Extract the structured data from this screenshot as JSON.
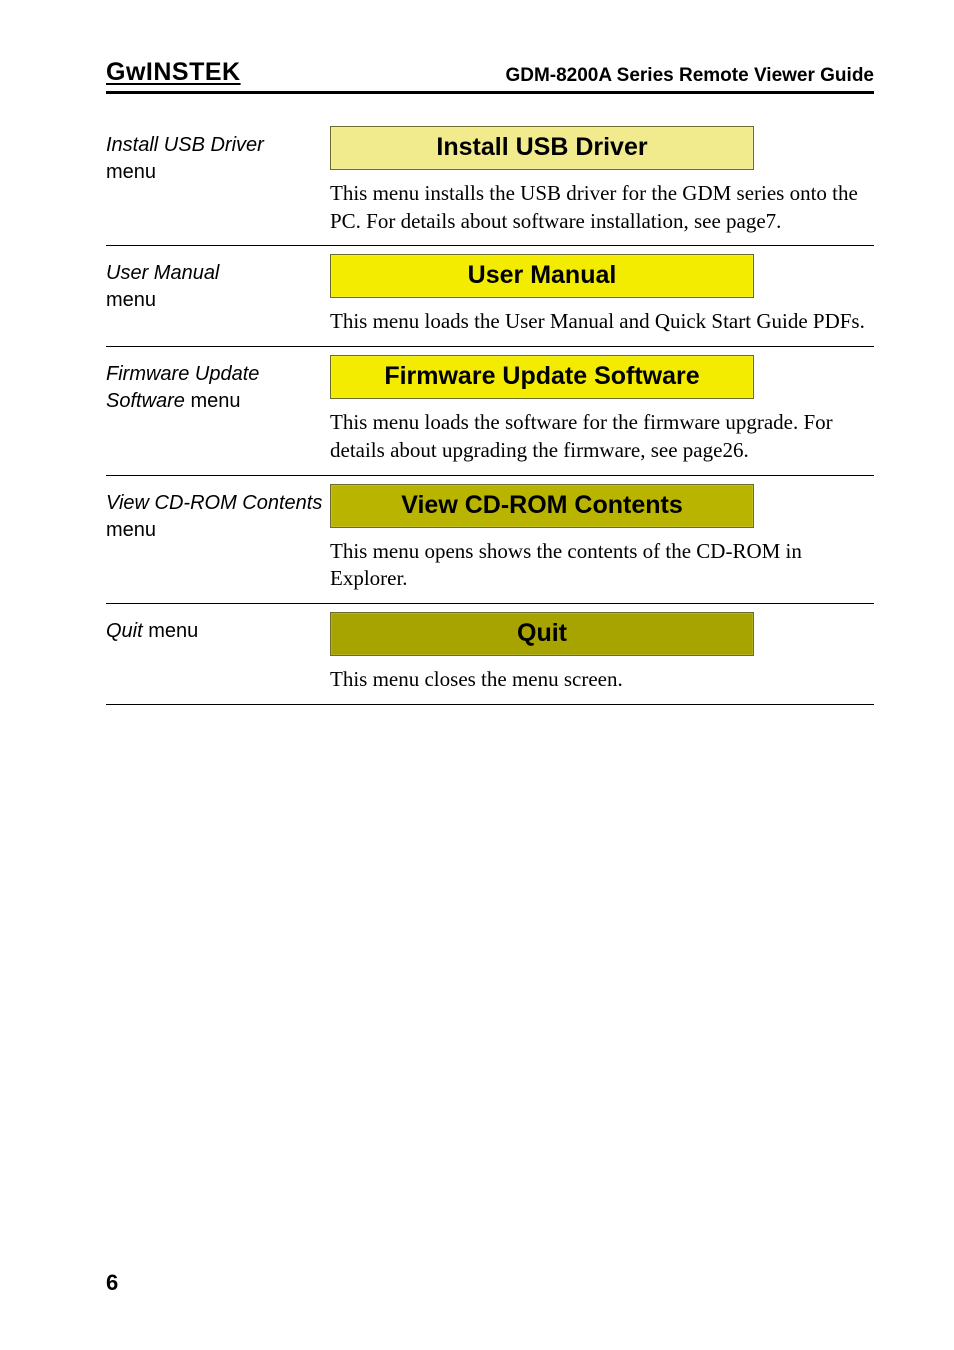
{
  "header": {
    "brand": "GᴡINSTEK",
    "title": "GDM-8200A Series Remote Viewer Guide"
  },
  "sections": [
    {
      "label_italic": "Install USB Driver",
      "label_plain": "menu",
      "button_text": "Install USB Driver",
      "button_class": "btn-light",
      "description": "This menu installs the USB driver for the GDM series onto the PC. For details about software installation, see page7."
    },
    {
      "label_italic": "User Manual",
      "label_plain": "menu",
      "button_text": "User Manual",
      "button_class": "btn-bright",
      "description": "This menu loads the User Manual and Quick Start Guide PDFs."
    },
    {
      "label_italic": "Firmware Update Software",
      "label_plain": " menu",
      "label_inline": true,
      "button_text": "Firmware Update Software",
      "button_class": "btn-bright",
      "description": "This menu loads the software for the firmware upgrade. For details about upgrading the firmware, see page26."
    },
    {
      "label_italic": "View CD-ROM Contents",
      "label_plain": " menu",
      "label_inline": true,
      "button_text": "View CD-ROM Contents",
      "button_class": "btn-olive1",
      "description": "This menu opens shows the contents of the CD-ROM in Explorer."
    },
    {
      "label_italic": "Quit",
      "label_plain": " menu",
      "label_inline": true,
      "button_text": "Quit",
      "button_class": "btn-olive2",
      "description": "This menu closes the menu screen."
    }
  ],
  "page_number": "6"
}
